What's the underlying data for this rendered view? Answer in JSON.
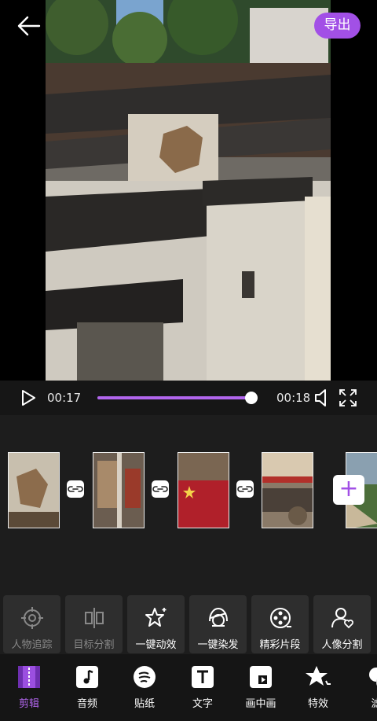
{
  "header": {
    "export_label": "导出"
  },
  "playback": {
    "current_time": "00:17",
    "total_time": "00:18",
    "progress": 0.99
  },
  "timeline": {
    "clips": [
      "clip-1",
      "clip-2",
      "clip-3",
      "clip-4",
      "clip-5"
    ]
  },
  "tools": [
    {
      "label": "人物追踪",
      "icon": "target-icon",
      "enabled": false
    },
    {
      "label": "目标分割",
      "icon": "split-icon",
      "enabled": false
    },
    {
      "label": "一键动效",
      "icon": "sparkle-star-icon",
      "enabled": true
    },
    {
      "label": "一键染发",
      "icon": "hair-dye-icon",
      "enabled": true
    },
    {
      "label": "精彩片段",
      "icon": "film-reel-icon",
      "enabled": true
    },
    {
      "label": "人像分割",
      "icon": "person-heart-icon",
      "enabled": true
    }
  ],
  "nav": [
    {
      "label": "剪辑",
      "icon": "clip-edit-icon",
      "active": true
    },
    {
      "label": "音频",
      "icon": "music-note-icon",
      "active": false
    },
    {
      "label": "贴纸",
      "icon": "sticker-icon",
      "active": false
    },
    {
      "label": "文字",
      "icon": "text-icon",
      "active": false
    },
    {
      "label": "画中画",
      "icon": "picture-in-picture-icon",
      "active": false
    },
    {
      "label": "特效",
      "icon": "effects-star-icon",
      "active": false
    },
    {
      "label": "滤",
      "icon": "filter-icon",
      "active": false
    }
  ],
  "colors": {
    "accent": "#a250e6",
    "progress": "#b266ee",
    "background": "#1d1d1d"
  }
}
